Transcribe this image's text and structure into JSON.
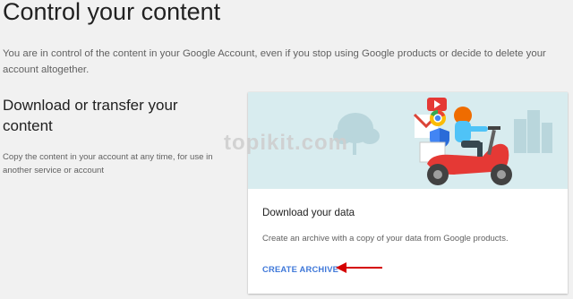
{
  "page": {
    "title": "Control your content",
    "intro": "You are in control of the content in your Google Account, even if you stop using Google products or decide to delete your account altogether."
  },
  "section": {
    "heading": "Download or transfer your content",
    "description": "Copy the content in your account at any time, for use in another service or account"
  },
  "card": {
    "title": "Download your data",
    "description": "Create an archive with a copy of your data from Google products.",
    "action_label": "CREATE ARCHIVE",
    "hero_background": "#d8ecef",
    "action_color": "#3f78d9"
  },
  "annotation": {
    "arrow_color": "#d50000",
    "arrow_icon": "left-arrow-icon"
  },
  "watermark": {
    "text": "topikit.com"
  }
}
